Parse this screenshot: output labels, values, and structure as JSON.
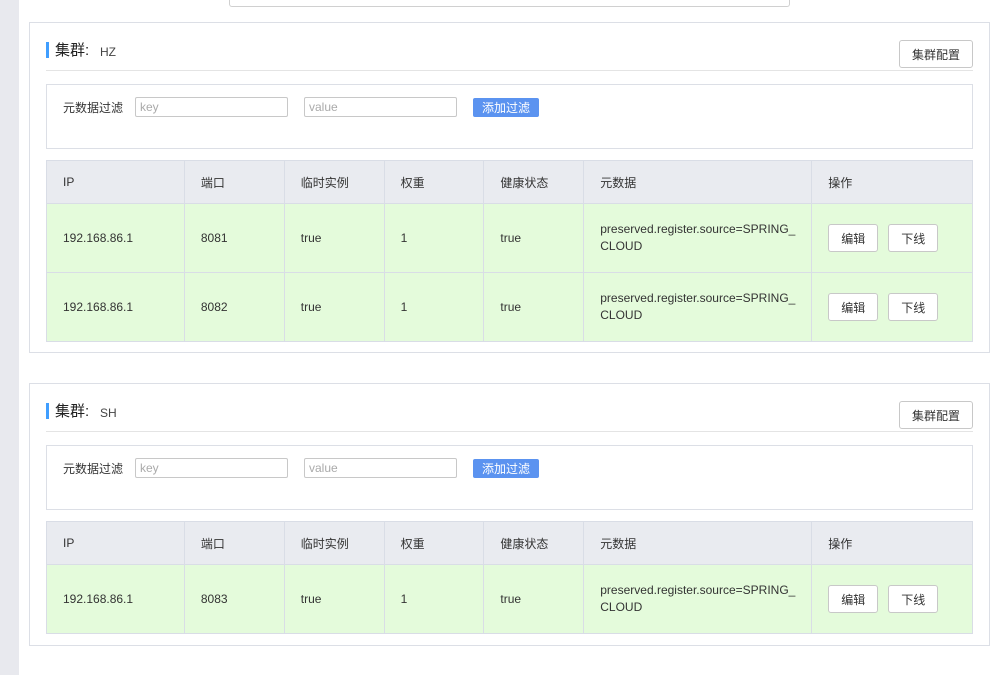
{
  "clusters": [
    {
      "title_label": "集群:",
      "name": "HZ",
      "config_button": "集群配置",
      "filter": {
        "label": "元数据过滤",
        "key_placeholder": "key",
        "value_placeholder": "value",
        "add_button": "添加过滤"
      },
      "columns": [
        "IP",
        "端口",
        "临时实例",
        "权重",
        "健康状态",
        "元数据",
        "操作"
      ],
      "rows": [
        {
          "ip": "192.168.86.1",
          "port": "8081",
          "ephemeral": "true",
          "weight": "1",
          "healthy": "true",
          "metadata_line1": "preserved.register.source=SPRING_",
          "metadata_line2": "CLOUD",
          "edit": "编辑",
          "offline": "下线"
        },
        {
          "ip": "192.168.86.1",
          "port": "8082",
          "ephemeral": "true",
          "weight": "1",
          "healthy": "true",
          "metadata_line1": "preserved.register.source=SPRING_",
          "metadata_line2": "CLOUD",
          "edit": "编辑",
          "offline": "下线"
        }
      ]
    },
    {
      "title_label": "集群:",
      "name": "SH",
      "config_button": "集群配置",
      "filter": {
        "label": "元数据过滤",
        "key_placeholder": "key",
        "value_placeholder": "value",
        "add_button": "添加过滤"
      },
      "columns": [
        "IP",
        "端口",
        "临时实例",
        "权重",
        "健康状态",
        "元数据",
        "操作"
      ],
      "rows": [
        {
          "ip": "192.168.86.1",
          "port": "8083",
          "ephemeral": "true",
          "weight": "1",
          "healthy": "true",
          "metadata_line1": "preserved.register.source=SPRING_",
          "metadata_line2": "CLOUD",
          "edit": "编辑",
          "offline": "下线"
        }
      ]
    }
  ],
  "colors": {
    "accent": "#409eff",
    "filter_button": "#5b93f0",
    "row_background": "#e4fbdb",
    "header_background": "#e9ebf0"
  }
}
